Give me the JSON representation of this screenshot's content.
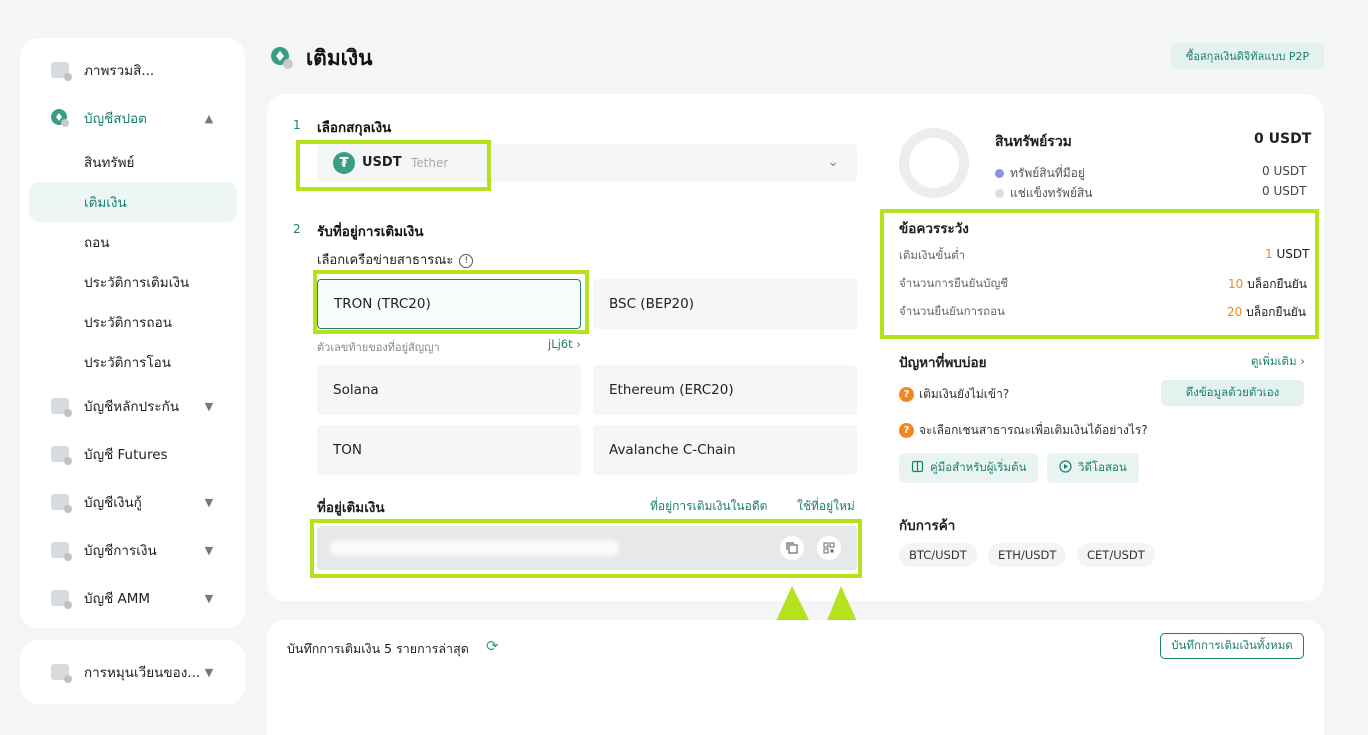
{
  "sidebar": {
    "items": [
      {
        "label": "ภาพรวมสิ...",
        "icon": "overview-icon"
      },
      {
        "label": "บัญชีสปอต",
        "icon": "spot-account-icon"
      },
      {
        "label": "บัญชีหลักประกัน",
        "icon": "margin-account-icon"
      },
      {
        "label": "บัญชี Futures",
        "icon": "futures-account-icon"
      },
      {
        "label": "บัญชีเงินกู้",
        "icon": "loan-account-icon"
      },
      {
        "label": "บัญชีการเงิน",
        "icon": "financial-account-icon"
      },
      {
        "label": "บัญชี AMM",
        "icon": "amm-account-icon"
      }
    ],
    "spot_sub": [
      "สินทรัพย์",
      "เติมเงิน",
      "ถอน",
      "ประวัติการเติมเงิน",
      "ประวัติการถอน",
      "ประวัติการโอน"
    ],
    "active_sub": "เติมเงิน",
    "bottom_item": "การหมุนเวียนของ..."
  },
  "header": {
    "title": "เติมเงิน",
    "p2p_button": "ซื้อสกุลเงินดิจิทัลแบบ P2P"
  },
  "step1": {
    "num": "1",
    "title": "เลือกสกุลเงิน",
    "coin_symbol": "USDT",
    "coin_name": "Tether"
  },
  "step2": {
    "num": "2",
    "title": "รับที่อยู่การเติมเงิน",
    "network_label": "เลือกเครือข่ายสาธารณะ",
    "networks": [
      "TRON (TRC20)",
      "BSC (BEP20)",
      "Solana",
      "Ethereum (ERC20)",
      "TON",
      "Avalanche C-Chain"
    ],
    "selected_network": "TRON (TRC20)",
    "contract_label": "ตัวเลขท้ายของที่อยู่สัญญา",
    "contract_value": "jLj6t ›"
  },
  "address": {
    "title": "ที่อยู่เติมเงิน",
    "past_link": "ที่อยู่การเติมเงินในอดีต",
    "new_link": "ใช้ที่อยู่ใหม่"
  },
  "assets": {
    "title": "สินทรัพย์รวม",
    "total": "0 USDT",
    "available_label": "ทรัพย์สินที่มีอยู่",
    "available_value": "0 USDT",
    "frozen_label": "แช่แข็งทรัพย์สิน",
    "frozen_value": "0 USDT",
    "available_color": "#8b8ff0",
    "frozen_color": "#dcdde2"
  },
  "caution": {
    "title": "ข้อควรระวัง",
    "rows": [
      {
        "label": "เติมเงินขั้นต่ำ",
        "num": "1",
        "unit": " USDT"
      },
      {
        "label": "จำนวนการยืนยันบัญชี",
        "num": "10",
        "unit": " บล็อกยืนยัน"
      },
      {
        "label": "จำนวนยืนยันการถอน",
        "num": "20",
        "unit": " บล็อกยืนยัน"
      }
    ]
  },
  "faq": {
    "title": "ปัญหาที่พบบ่อย",
    "more": "ดูเพิ่มเติม ›",
    "q1": "เติมเงินยังไม่เข้า?",
    "q2": "จะเลือกเชนสาธารณะเพื่อเติมเงินได้อย่างไร?",
    "pull_button": "ดึงข้อมูลด้วยตัวเอง",
    "guide_button": "คู่มือสำหรับผู้เริ่มต้น",
    "video_button": "วิดีโอสอน"
  },
  "trade": {
    "title": "กับการค้า",
    "pairs": [
      "BTC/USDT",
      "ETH/USDT",
      "CET/USDT"
    ]
  },
  "recent": {
    "label": "บันทึกการเติมเงิน 5 รายการล่าสุด",
    "all_button": "บันทึกการเติมเงินทั้งหมด"
  },
  "colors": {
    "accent": "#1b7f6e",
    "highlight": "#b5e21d",
    "warning": "#f0871f"
  }
}
